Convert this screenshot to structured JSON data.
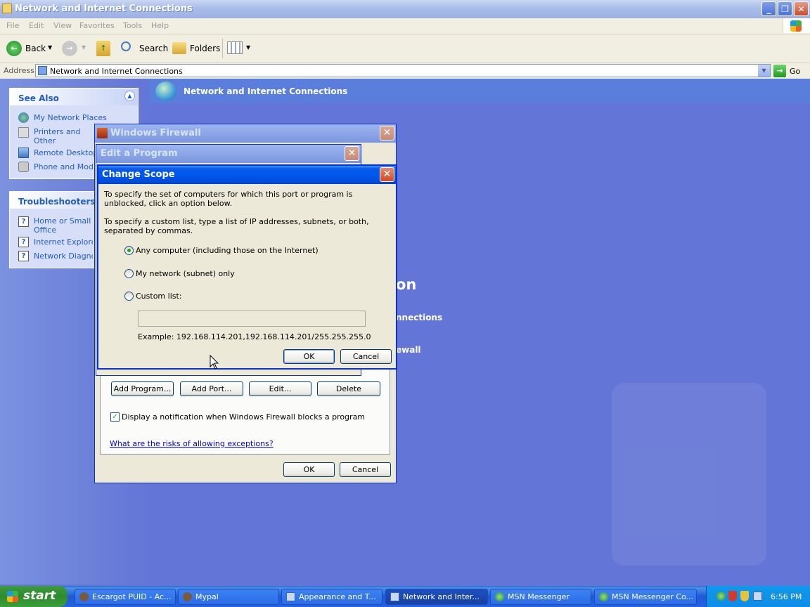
{
  "window": {
    "title": "Network and Internet Connections",
    "menu": [
      "File",
      "Edit",
      "View",
      "Favorites",
      "Tools",
      "Help"
    ],
    "toolbar": {
      "back": "Back",
      "search": "Search",
      "folders": "Folders"
    },
    "address_label": "Address",
    "address_value": "Network and Internet Connections",
    "go_label": "Go"
  },
  "see_also": {
    "title": "See Also",
    "items": [
      "My Network Places",
      "Printers and Other Hardware",
      "Remote Desktop",
      "Phone and Modem"
    ]
  },
  "troubleshooters": {
    "title": "Troubleshooters",
    "items": [
      "Home or Small Office Networking",
      "Internet Explorer",
      "Network Diagnostics"
    ]
  },
  "header_title": "Network and Internet Connections",
  "background_fragments": {
    "heading": "on",
    "link1": "nnections",
    "link2": "ewall"
  },
  "firewall": {
    "title": "Windows Firewall",
    "buttons": {
      "add_program": "Add Program...",
      "add_port": "Add Port...",
      "edit": "Edit...",
      "delete": "Delete",
      "ok": "OK",
      "cancel": "Cancel"
    },
    "notification_label": "Display a notification when Windows Firewall blocks a program",
    "risks_link": "What are the risks of allowing exceptions?"
  },
  "edit_program": {
    "title": "Edit a Program"
  },
  "change_scope": {
    "title": "Change Scope",
    "intro": "To specify the set of computers for which this port or program is unblocked, click an option below.",
    "custom_hint": "To specify a custom list, type a list of IP addresses, subnets, or both, separated by commas.",
    "options": [
      "Any computer (including those on the Internet)",
      "My network (subnet) only",
      "Custom list:"
    ],
    "selected_option": 0,
    "custom_value": "",
    "example": "Example: 192.168.114.201,192.168.114.201/255.255.255.0",
    "ok": "OK",
    "cancel": "Cancel"
  },
  "taskbar": {
    "start": "start",
    "items": [
      "Escargot PUID - Ac...",
      "Mypal",
      "Appearance and T...",
      "Network and Inter...",
      "MSN Messenger",
      "MSN Messenger Co..."
    ],
    "active_index": 3,
    "clock": "6:56 PM"
  }
}
